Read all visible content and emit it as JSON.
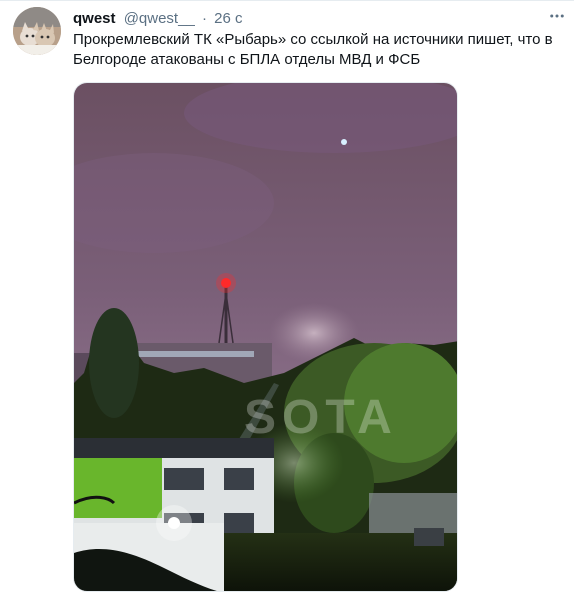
{
  "tweet": {
    "author_name": "qwest",
    "author_handle": "@qwest__",
    "separator": "·",
    "time": "26 с",
    "text": "Прокремлевский ТК «Рыбарь» со ссылкой на источники пишет, что в Белгороде атакованы с БПЛА отделы МВД и ФСБ"
  },
  "media": {
    "watermark": "SOTA",
    "sky_color": "#6e5570",
    "tower_light_color": "#ff2a2a"
  },
  "icons": {
    "more": "more-icon"
  }
}
